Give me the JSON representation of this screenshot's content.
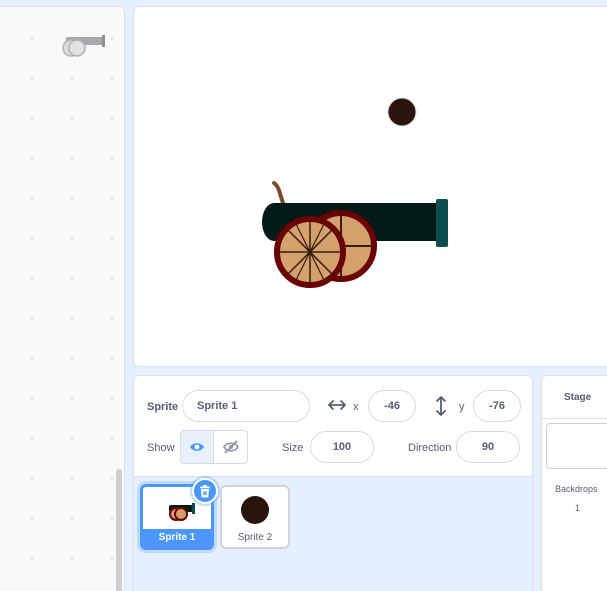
{
  "sprite_info": {
    "sprite_label": "Sprite",
    "sprite_name": "Sprite 1",
    "x_label": "x",
    "x_value": "-46",
    "y_label": "y",
    "y_value": "-76",
    "show_label": "Show",
    "size_label": "Size",
    "size_value": "100",
    "direction_label": "Direction",
    "direction_value": "90"
  },
  "sprites": [
    {
      "name": "Sprite 1",
      "selected": true
    },
    {
      "name": "Sprite 2",
      "selected": false
    }
  ],
  "stage_pane": {
    "title": "Stage",
    "backdrops_label": "Backdrops",
    "backdrops_count": "1"
  },
  "colors": {
    "accent": "#4c97ff",
    "background": "#e5f0ff",
    "cannon_barrel": "#001a17",
    "cannon_muzzle": "#0d4d4d",
    "wheel_rim": "#6b0000",
    "wheel_fill": "#d2a16d",
    "cannonball": "#2a150c"
  },
  "icons": {
    "x_axis": "horizontal-arrows-icon",
    "y_axis": "vertical-arrows-icon",
    "show": "eye-icon",
    "hide": "eye-slash-icon",
    "delete": "trash-icon"
  }
}
